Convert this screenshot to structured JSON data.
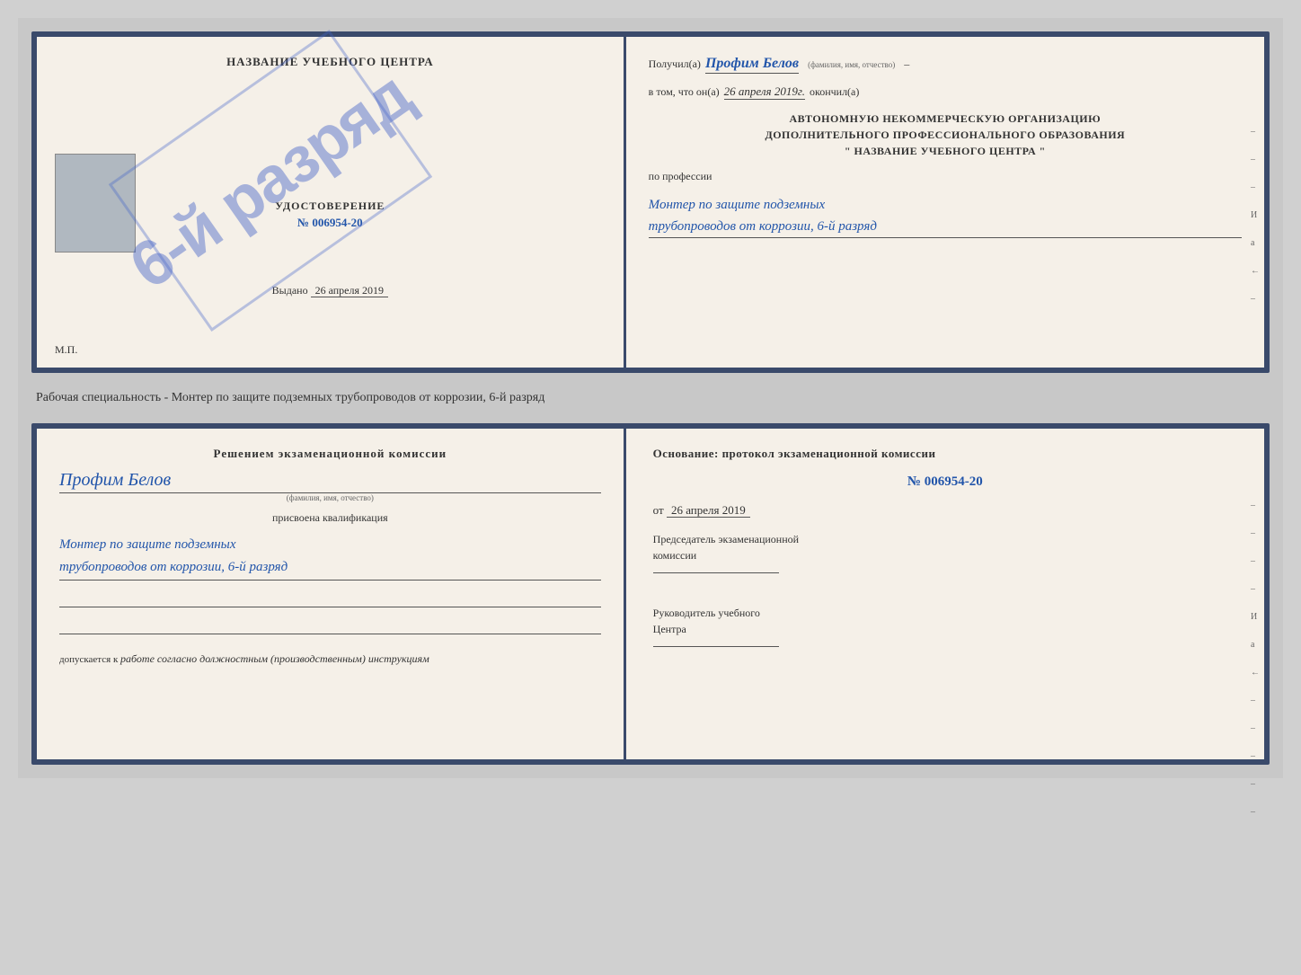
{
  "top_doc": {
    "left": {
      "center_title": "НАЗВАНИЕ УЧЕБНОГО ЦЕНТРА",
      "stamp_text": "6-й разряд",
      "certificate_title": "УДОСТОВЕРЕНИЕ",
      "certificate_number": "№ 006954-20",
      "issued_label": "Выдано",
      "issued_date": "26 апреля 2019",
      "mp_label": "М.П."
    },
    "right": {
      "recipient_prefix": "Получил(а)",
      "recipient_name": "Профим Белов",
      "recipient_hint": "(фамилия, имя, отчество)",
      "date_prefix": "в том, что он(а)",
      "date_value": "26 апреля 2019г.",
      "date_suffix": "окончил(а)",
      "org_line1": "АВТОНОМНУЮ НЕКОММЕРЧЕСКУЮ ОРГАНИЗАЦИЮ",
      "org_line2": "ДОПОЛНИТЕЛЬНОГО ПРОФЕССИОНАЛЬНОГО ОБРАЗОВАНИЯ",
      "org_line3": "\"   НАЗВАНИЕ УЧЕБНОГО ЦЕНТРА   \"",
      "profession_label": "по профессии",
      "profession_line1": "Монтер по защите подземных",
      "profession_line2": "трубопроводов от коррозии, 6-й разряд",
      "side_marks": [
        "–",
        "–",
        "–",
        "И",
        "а",
        "←",
        "–"
      ]
    }
  },
  "between": {
    "text": "Рабочая специальность - Монтер по защите подземных трубопроводов от коррозии, 6-й разряд"
  },
  "bottom_doc": {
    "left": {
      "decision_text": "Решением экзаменационной комиссии",
      "person_name": "Профим Белов",
      "person_hint": "(фамилия, имя, отчество)",
      "qualification_label": "присвоена квалификация",
      "qualification_line1": "Монтер по защите подземных",
      "qualification_line2": "трубопроводов от коррозии, 6-й разряд",
      "допускается_prefix": "допускается к",
      "допускается_text": "работе согласно должностным (производственным) инструкциям"
    },
    "right": {
      "basis_text": "Основание: протокол экзаменационной комиссии",
      "protocol_number": "№  006954-20",
      "date_prefix": "от",
      "date_value": "26 апреля 2019",
      "chairman_line1": "Председатель экзаменационной",
      "chairman_line2": "комиссии",
      "director_line1": "Руководитель учебного",
      "director_line2": "Центра",
      "side_marks": [
        "–",
        "–",
        "–",
        "–",
        "И",
        "а",
        "←",
        "–",
        "–",
        "–",
        "–",
        "–"
      ]
    }
  }
}
